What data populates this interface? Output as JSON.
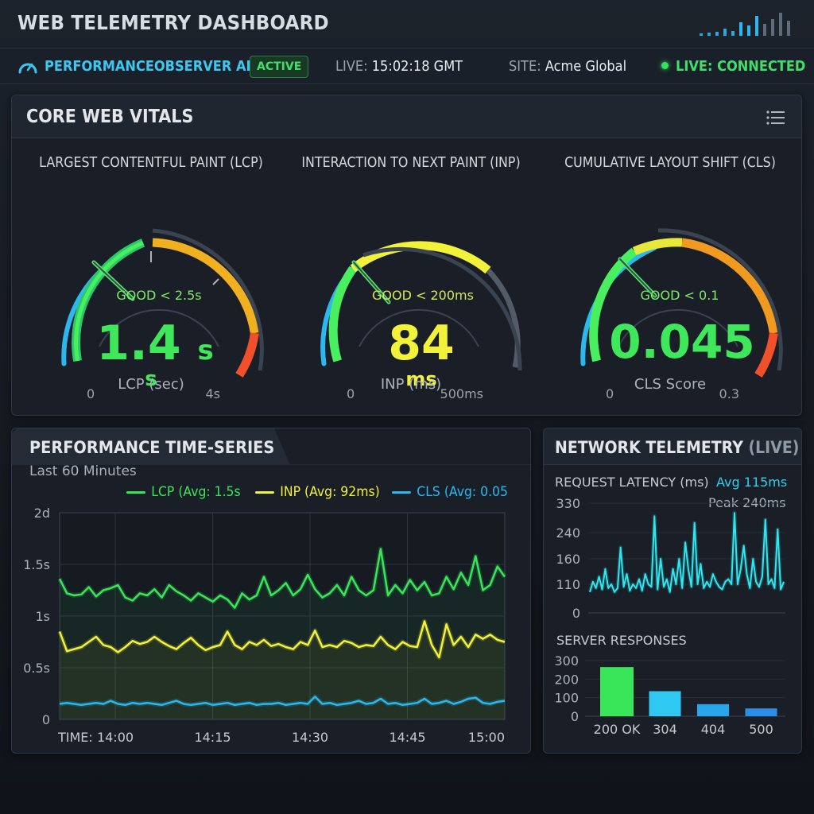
{
  "app": {
    "title": "WEB TELEMETRY DASHBOARD"
  },
  "status": {
    "api_label": "PERFORMANCEOBSERVER API",
    "api_badge": "ACTIVE",
    "live_label": "LIVE:",
    "live_time": "15:02:18 GMT",
    "site_label": "SITE:",
    "site_value": "Acme Global",
    "connection": "LIVE: CONNECTED"
  },
  "colors": {
    "green": "#39e65a",
    "yellow": "#f2f23a",
    "blue": "#2ab8ef",
    "cyan": "#2fe6f0",
    "orange": "#f29a1d",
    "red": "#f04a2a"
  },
  "vitals": {
    "title": "CORE WEB VITALS",
    "gauges": [
      {
        "title": "LARGEST CONTENTFUL PAINT (LCP)",
        "good": "GOOD < 2.5s",
        "value": "1.4",
        "unit_inline": "s",
        "unit": "s",
        "min_label": "0",
        "max_label": "4s",
        "caption": "LCP (sec)",
        "value_color": "#39e65a",
        "needle_fraction": 0.35
      },
      {
        "title": "INTERACTION TO NEXT PAINT (INP)",
        "good": "GOOD < 200ms",
        "value": "84",
        "unit_inline": "",
        "unit": "ms",
        "min_label": "0",
        "max_label": "500ms",
        "caption": "INP (ms)",
        "value_color": "#f2f23a",
        "needle_fraction": 0.17
      },
      {
        "title": "CUMULATIVE LAYOUT SHIFT (CLS)",
        "good": "GOOD < 0.1",
        "value": "0.045",
        "unit_inline": "",
        "unit": "",
        "min_label": "0",
        "max_label": "0.3",
        "caption": "CLS Score",
        "value_color": "#39e65a",
        "needle_fraction": 0.15
      }
    ]
  },
  "timeseries": {
    "title": "PERFORMANCE TIME-SERIES",
    "subtitle": "Last 60 Minutes",
    "legend": [
      {
        "label": "LCP (Avg: 1.5s",
        "color": "#39e65a"
      },
      {
        "label": "INP (Avg: 92ms)",
        "color": "#f2f23a"
      },
      {
        "label": "CLS (Avg: 0.05",
        "color": "#2ab8ef"
      }
    ],
    "y_ticks": [
      "2d",
      "1.5s",
      "1s",
      "0.5s",
      "0"
    ],
    "x_prefix": "TIME:",
    "x_ticks": [
      "14:00",
      "14:15",
      "14:30",
      "14:45",
      "15:00"
    ]
  },
  "network": {
    "title": "NETWORK TELEMETRY",
    "title_suffix": "(LIVE)",
    "latency_label": "REQUEST LATENCY (ms)",
    "latency_avg": "Avg 115ms",
    "latency_peak": "Peak 240ms",
    "latency_ticks": [
      "330",
      "240",
      "160",
      "110",
      "0"
    ],
    "responses_label": "SERVER RESPONSES",
    "responses_ticks": [
      "300",
      "200",
      "100",
      "0"
    ]
  },
  "chart_data": [
    {
      "type": "line",
      "title": "PERFORMANCE TIME-SERIES",
      "xlabel": "TIME:",
      "x_ticks": [
        "14:00",
        "14:15",
        "14:30",
        "14:45",
        "15:00"
      ],
      "ylim": [
        0,
        2
      ],
      "series": [
        {
          "name": "LCP (Avg: 1.5s",
          "color": "#39e65a",
          "values": [
            1.36,
            1.22,
            1.2,
            1.21,
            1.28,
            1.19,
            1.25,
            1.27,
            1.3,
            1.18,
            1.15,
            1.22,
            1.2,
            1.26,
            1.18,
            1.3,
            1.24,
            1.2,
            1.15,
            1.22,
            1.18,
            1.14,
            1.2,
            1.16,
            1.08,
            1.22,
            1.16,
            1.2,
            1.38,
            1.2,
            1.25,
            1.32,
            1.2,
            1.26,
            1.4,
            1.26,
            1.18,
            1.22,
            1.3,
            1.2,
            1.38,
            1.25,
            1.2,
            1.25,
            1.65,
            1.2,
            1.3,
            1.22,
            1.35,
            1.25,
            1.33,
            1.2,
            1.22,
            1.38,
            1.26,
            1.42,
            1.3,
            1.58,
            1.25,
            1.3,
            1.48,
            1.38
          ]
        },
        {
          "name": "INP (Avg: 92ms)",
          "color": "#f2f23a",
          "values": [
            0.85,
            0.66,
            0.68,
            0.7,
            0.75,
            0.8,
            0.72,
            0.7,
            0.65,
            0.7,
            0.76,
            0.73,
            0.75,
            0.8,
            0.75,
            0.71,
            0.68,
            0.74,
            0.79,
            0.72,
            0.67,
            0.7,
            0.72,
            0.85,
            0.72,
            0.68,
            0.75,
            0.72,
            0.77,
            0.71,
            0.73,
            0.7,
            0.68,
            0.75,
            0.72,
            0.86,
            0.7,
            0.72,
            0.7,
            0.76,
            0.74,
            0.7,
            0.72,
            0.71,
            0.8,
            0.72,
            0.68,
            0.75,
            0.71,
            0.7,
            0.95,
            0.72,
            0.6,
            0.92,
            0.72,
            0.8,
            0.7,
            0.82,
            0.78,
            0.82,
            0.77,
            0.75
          ]
        },
        {
          "name": "CLS (Avg: 0.05",
          "color": "#2ab8ef",
          "values": [
            0.15,
            0.16,
            0.15,
            0.14,
            0.15,
            0.16,
            0.15,
            0.18,
            0.15,
            0.14,
            0.16,
            0.15,
            0.16,
            0.15,
            0.14,
            0.16,
            0.18,
            0.15,
            0.14,
            0.15,
            0.16,
            0.14,
            0.15,
            0.16,
            0.14,
            0.15,
            0.16,
            0.14,
            0.15,
            0.15,
            0.16,
            0.14,
            0.15,
            0.16,
            0.15,
            0.22,
            0.15,
            0.16,
            0.14,
            0.15,
            0.16,
            0.18,
            0.15,
            0.16,
            0.2,
            0.15,
            0.16,
            0.14,
            0.15,
            0.16,
            0.2,
            0.15,
            0.16,
            0.18,
            0.15,
            0.17,
            0.2,
            0.21,
            0.16,
            0.15,
            0.17,
            0.18
          ]
        }
      ]
    },
    {
      "type": "line",
      "title": "REQUEST LATENCY (ms)",
      "ylim": [
        0,
        330
      ],
      "series": [
        {
          "name": "",
          "color": "#2fe6f0",
          "values": [
            80,
            115,
            95,
            125,
            90,
            140,
            95,
            110,
            80,
            95,
            195,
            100,
            130,
            85,
            110,
            95,
            120,
            85,
            130,
            110,
            100,
            290,
            90,
            160,
            100,
            120,
            80,
            140,
            110,
            160,
            95,
            210,
            140,
            100,
            270,
            110,
            150,
            95,
            115,
            100,
            130,
            115,
            100,
            90,
            115,
            120,
            110,
            300,
            110,
            140,
            200,
            130,
            95,
            160,
            115,
            100,
            125,
            280,
            110,
            120,
            95,
            250,
            90,
            115
          ]
        }
      ]
    },
    {
      "type": "bar",
      "title": "SERVER RESPONSES",
      "categories": [
        "200 OK",
        "304",
        "404",
        "500"
      ],
      "values": [
        265,
        135,
        65,
        42
      ],
      "colors": [
        "#39e65a",
        "#2fc8f0",
        "#27a6ee",
        "#2a8fe8"
      ],
      "ylim": [
        0,
        300
      ]
    }
  ]
}
